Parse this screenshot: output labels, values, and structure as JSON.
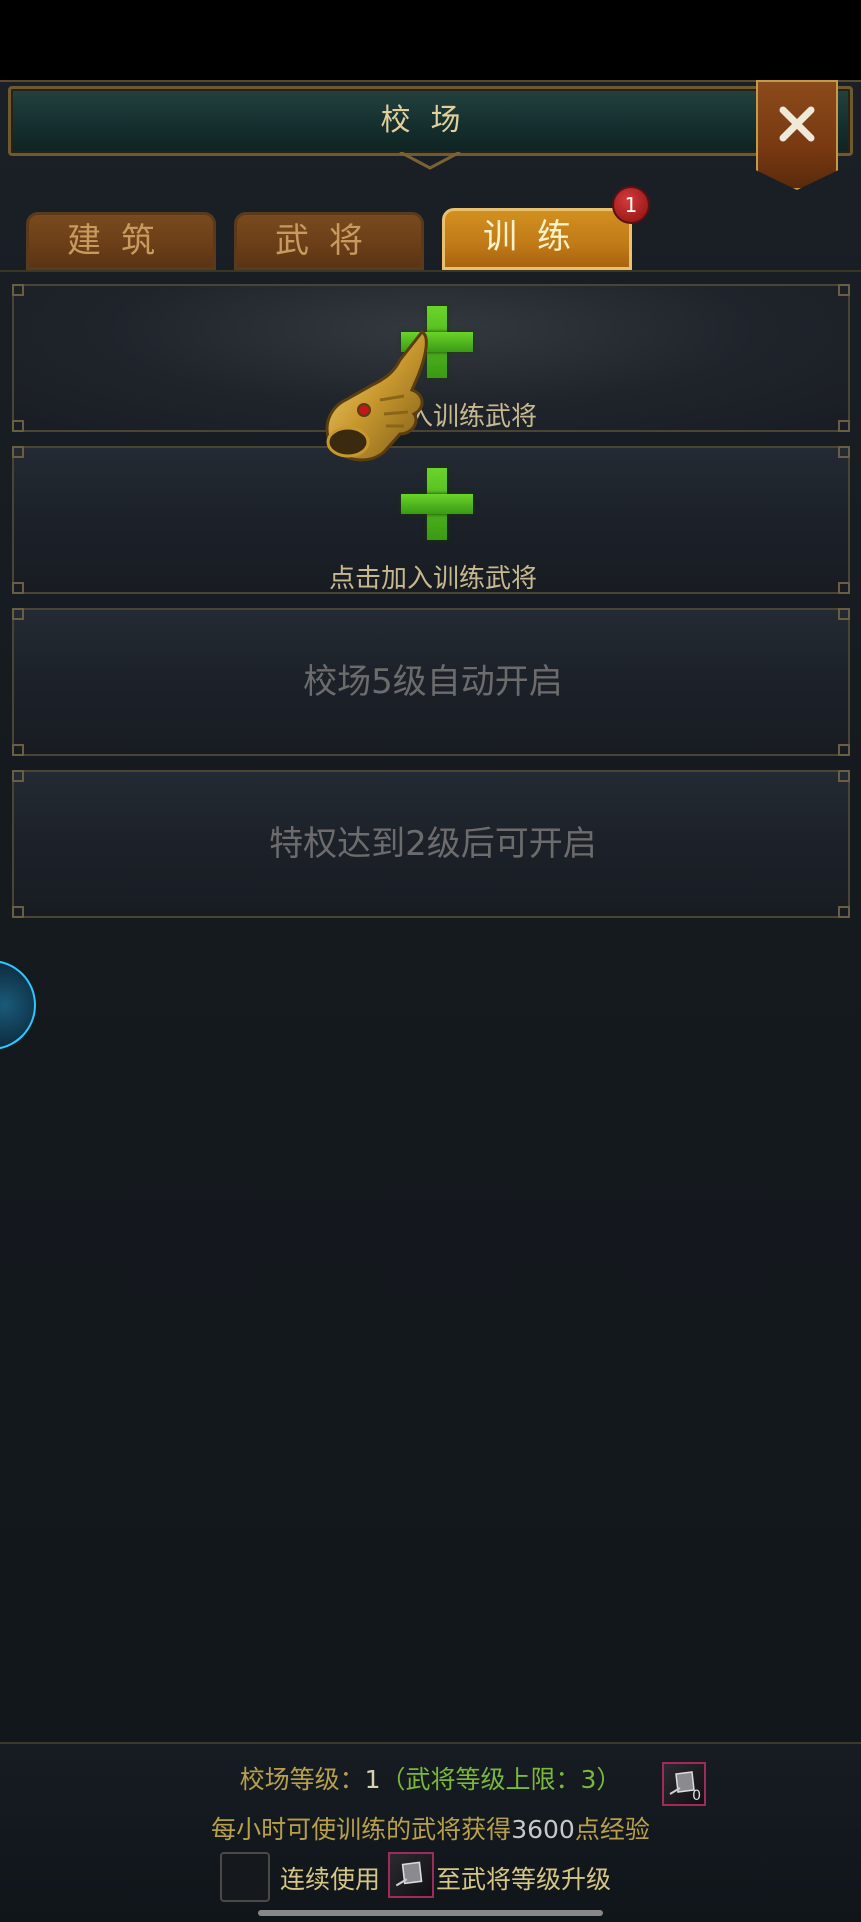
{
  "window": {
    "title": "校场",
    "close_icon": "close-icon"
  },
  "tabs": [
    {
      "label": "建筑",
      "active": false
    },
    {
      "label": "武将",
      "active": false
    },
    {
      "label": "训练",
      "active": true,
      "badge": "1"
    }
  ],
  "slots": [
    {
      "label": "点击加入训练武将",
      "state": "empty",
      "icon": "plus-icon"
    },
    {
      "label": "点击加入训练武将",
      "state": "empty",
      "icon": "plus-icon"
    },
    {
      "label": "校场5级自动开启",
      "state": "locked"
    },
    {
      "label": "特权达到2级后可开启",
      "state": "locked"
    }
  ],
  "footer": {
    "level_prefix": "校场等级：",
    "level_value": "1",
    "level_cap_text": "（武将等级上限：",
    "level_cap_value": "3",
    "level_cap_close": "）",
    "item_count": "0",
    "exp_prefix": "每小时可使训练的武将获得",
    "exp_value": "3600",
    "exp_suffix": "点经验",
    "continuous_prefix": "连续使用",
    "continuous_suffix": "至武将等级升级"
  },
  "colors": {
    "accent_gold": "#d29020",
    "plus_green": "#4ab820",
    "cap_green": "#7ab83a",
    "badge_red": "#b02020"
  }
}
